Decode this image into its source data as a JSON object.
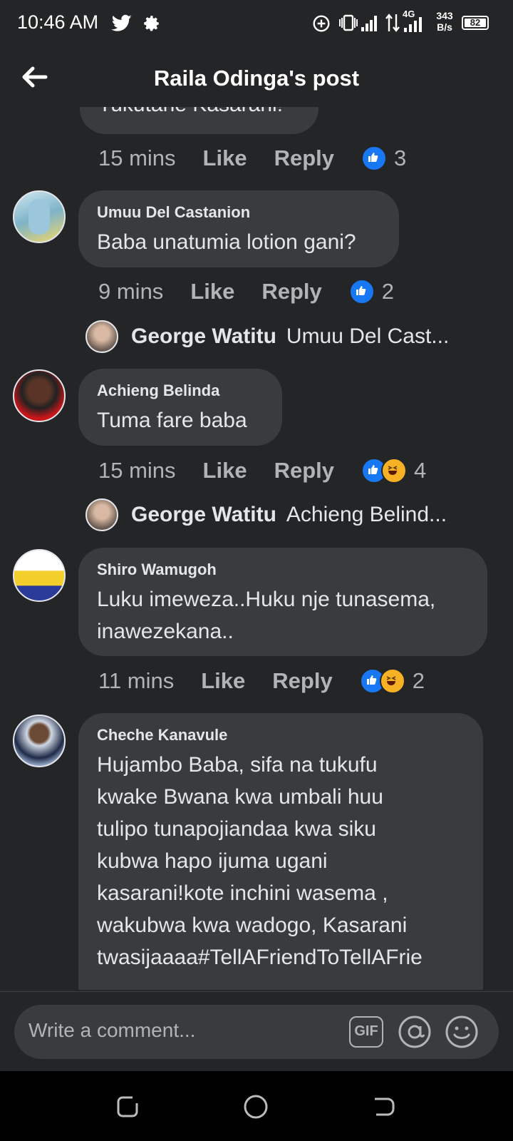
{
  "status": {
    "time": "10:46 AM",
    "network": "4G",
    "speed_top": "343",
    "speed_bottom": "B/s",
    "battery": "82"
  },
  "header": {
    "title": "Raila Odinga's post"
  },
  "partial_comment": {
    "text": "Tukutane Kasarani!",
    "time": "15 mins",
    "like": "Like",
    "reply": "Reply",
    "count": "3"
  },
  "comments": [
    {
      "author": "Umuu Del Castanion",
      "text": "Baba unatumia lotion gani?",
      "time": "9 mins",
      "like": "Like",
      "reply": "Reply",
      "count": "2",
      "reply_preview": {
        "name": "George Watitu",
        "text": "Umuu Del Cast..."
      }
    },
    {
      "author": "Achieng Belinda",
      "text": "Tuma fare baba",
      "time": "15 mins",
      "like": "Like",
      "reply": "Reply",
      "count": "4",
      "reply_preview": {
        "name": "George Watitu",
        "text": "Achieng Belind..."
      }
    },
    {
      "author": "Shiro Wamugoh",
      "lines": [
        "Luku imeweza..Huku nje tunasema,",
        "inawezekana.."
      ],
      "time": "11 mins",
      "like": "Like",
      "reply": "Reply",
      "count": "2"
    },
    {
      "author": "Cheche Kanavule",
      "lines": [
        "Hujambo Baba, sifa na tukufu",
        "kwake Bwana kwa umbali huu",
        "tulipo tunapojiandaa kwa siku",
        "kubwa hapo ijuma ugani",
        "kasarani!kote inchini wasema ,",
        "wakubwa kwa wadogo, Kasarani",
        "twasijaaaa#TellAFriendToTellAFrie"
      ]
    }
  ],
  "composer": {
    "placeholder": "Write a comment...",
    "gif": "GIF"
  },
  "colors": {
    "background": "#242526",
    "bubble": "#3a3b3c",
    "like_blue": "#1877f2"
  }
}
